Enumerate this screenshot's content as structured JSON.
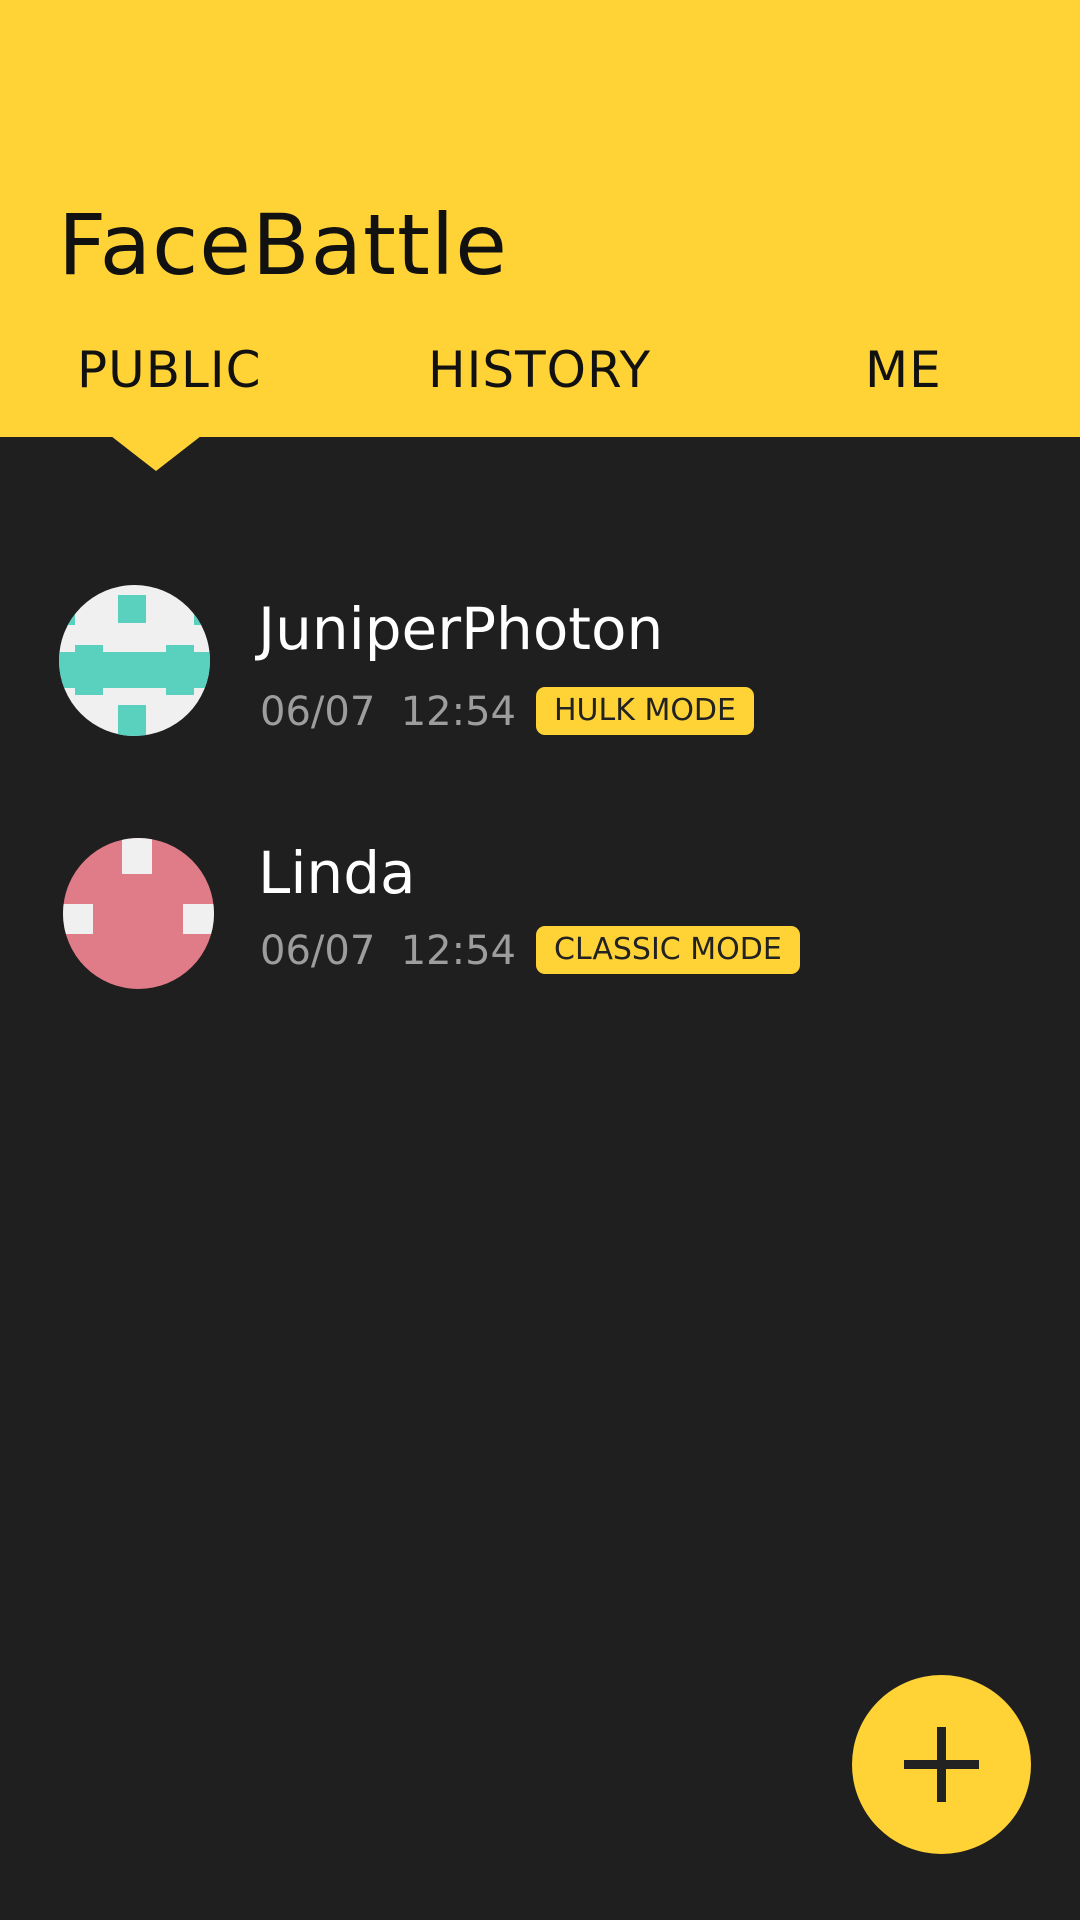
{
  "app": {
    "title": "FaceBattle",
    "accent_color": "#ffd236",
    "background_color": "#1f1f1f"
  },
  "tabs": [
    {
      "label": "PUBLIC",
      "selected": true
    },
    {
      "label": "HISTORY",
      "selected": false
    },
    {
      "label": "ME",
      "selected": false
    }
  ],
  "battles": [
    {
      "name": "JuniperPhoton",
      "date": "06/07",
      "time": "12:54",
      "mode": "HULK MODE",
      "avatar_icon": "teal-pattern-avatar-icon",
      "avatar_color": "#5ad0be"
    },
    {
      "name": "Linda",
      "date": "06/07",
      "time": "12:54",
      "mode": "CLASSIC MODE",
      "avatar_icon": "pink-pattern-avatar-icon",
      "avatar_color": "#e07b88"
    }
  ],
  "fab": {
    "icon": "plus-icon"
  }
}
